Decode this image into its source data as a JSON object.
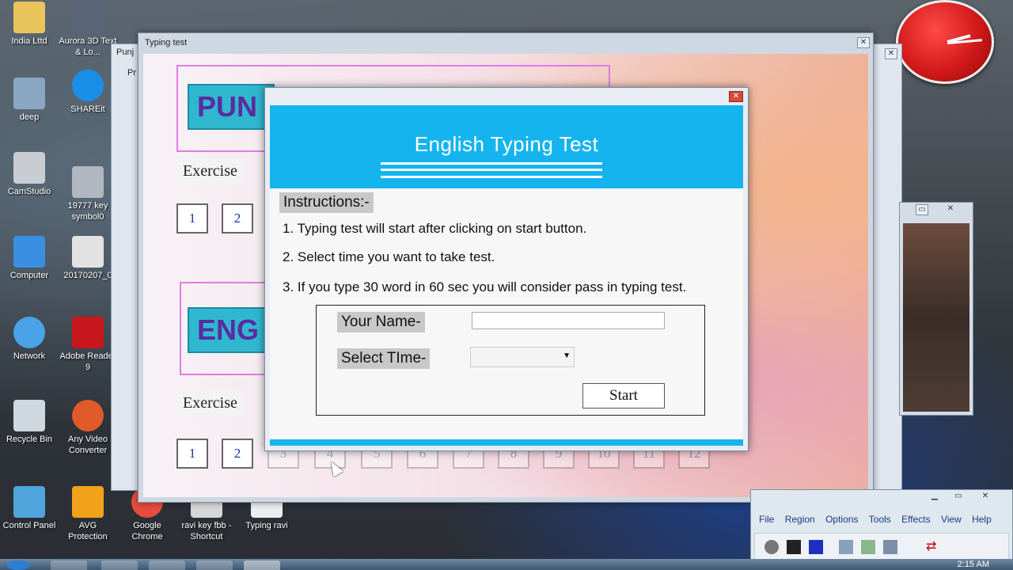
{
  "desktop": {
    "icons": [
      {
        "label": "India Lttd"
      },
      {
        "label": "Aurora 3D Text & Lo..."
      },
      {
        "label": "deep"
      },
      {
        "label": "SHAREit"
      },
      {
        "label": "CamStudio"
      },
      {
        "label": "19777 key symbol0"
      },
      {
        "label": "Computer"
      },
      {
        "label": "20170207_0"
      },
      {
        "label": "Network"
      },
      {
        "label": "Adobe Reader 9"
      },
      {
        "label": "Recycle Bin"
      },
      {
        "label": "Any Video Converter"
      },
      {
        "label": "Control Panel"
      },
      {
        "label": "AVG Protection"
      },
      {
        "label": "Google Chrome"
      },
      {
        "label": "ravi key fbb - Shortcut"
      },
      {
        "label": "Typing ravi"
      }
    ]
  },
  "main_window": {
    "title": "Typing test",
    "back_title": "Punj",
    "back_sub": "Pr",
    "banner1": "PUN",
    "banner2": "ENG",
    "exercise1": "Exercise",
    "exercise2": "Exercise",
    "row1": [
      "1",
      "2"
    ],
    "row2": [
      "1",
      "2",
      "3",
      "4",
      "5",
      "6",
      "7",
      "8",
      "9",
      "10",
      "11",
      "12"
    ]
  },
  "dialog": {
    "header": "English Typing Test",
    "instructions_title": "Instructions:-",
    "instructions": [
      "1. Typing test will start after clicking on start button.",
      "2. Select time you want to take test.",
      "3. If you type 30 word  in 60 sec  you will consider pass in typing test."
    ],
    "name_label": "Your Name-",
    "name_value": "",
    "time_label": "Select TIme-",
    "time_value": "",
    "start_label": "Start"
  },
  "paint_app": {
    "menu": [
      "File",
      "Region",
      "Options",
      "Tools",
      "Effects",
      "View",
      "Help"
    ]
  },
  "taskbar": {
    "time": "2:15 AM"
  }
}
